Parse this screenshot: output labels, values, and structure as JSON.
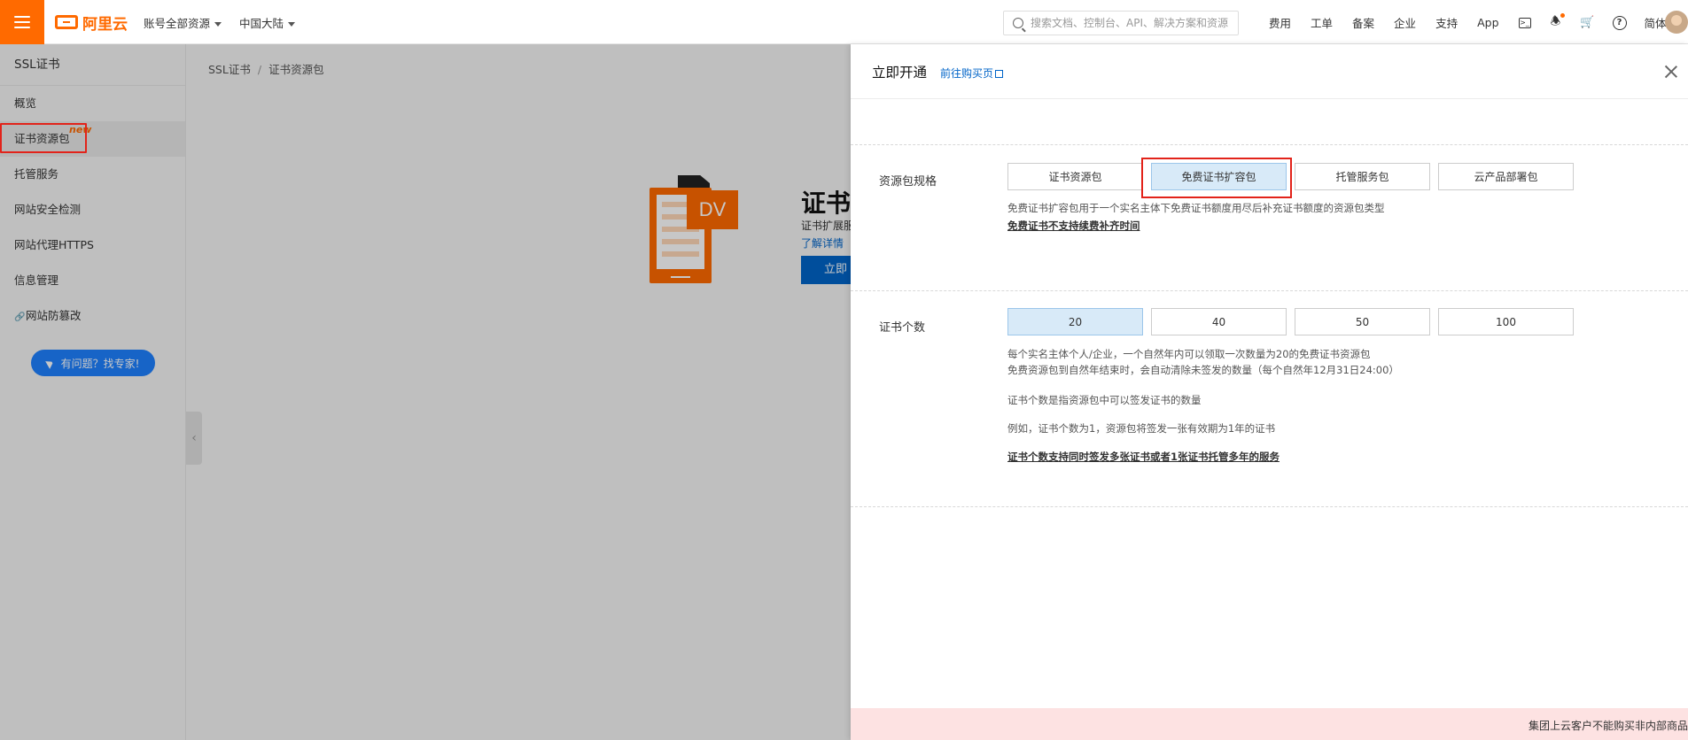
{
  "topbar": {
    "logo_text": "阿里云",
    "account_scope": "账号全部资源",
    "region": "中国大陆",
    "search_placeholder": "搜索文档、控制台、API、解决方案和资源",
    "nav": [
      "费用",
      "工单",
      "备案",
      "企业",
      "支持",
      "App"
    ],
    "lang": "简体",
    "accent_color": "#ff6a00"
  },
  "sidebar": {
    "title": "SSL证书",
    "items": [
      {
        "label": "概览"
      },
      {
        "label": "证书资源包",
        "badge": "new"
      },
      {
        "label": "托管服务"
      },
      {
        "label": "网站安全检测"
      },
      {
        "label": "网站代理HTTPS"
      },
      {
        "label": "信息管理"
      },
      {
        "label": "网站防篡改"
      }
    ],
    "help_button": "有问题？找专家!"
  },
  "main": {
    "breadcrumb": [
      "SSL证书",
      "证书资源包"
    ],
    "hero_badge": "DV",
    "hero_title": "证书",
    "hero_desc": "证书扩展服",
    "hero_link": "了解详情",
    "hero_button": "立即"
  },
  "drawer": {
    "title": "立即开通",
    "buy_link": "前往购买页",
    "spec": {
      "label": "资源包规格",
      "options": [
        "证书资源包",
        "免费证书扩容包",
        "托管服务包",
        "云产品部署包"
      ],
      "selected": "免费证书扩容包",
      "note": "免费证书扩容包用于一个实名主体下免费证书额度用尽后补充证书额度的资源包类型",
      "note_link": "免费证书不支持续费补齐时间"
    },
    "count": {
      "label": "证书个数",
      "options": [
        "20",
        "40",
        "50",
        "100"
      ],
      "selected": "20",
      "notes": [
        "每个实名主体个人/企业，一个自然年内可以领取一次数量为20的免费证书资源包",
        "免费资源包到自然年结束时，会自动清除未签发的数量（每个自然年12月31日24:00）",
        "证书个数是指资源包中可以签发证书的数量",
        "例如，证书个数为1，资源包将签发一张有效期为1年的证书"
      ],
      "note_link": "证书个数支持同时签发多张证书或者1张证书托管多年的服务"
    },
    "bottom_notice": "集团上云客户不能购买非内部商品"
  }
}
